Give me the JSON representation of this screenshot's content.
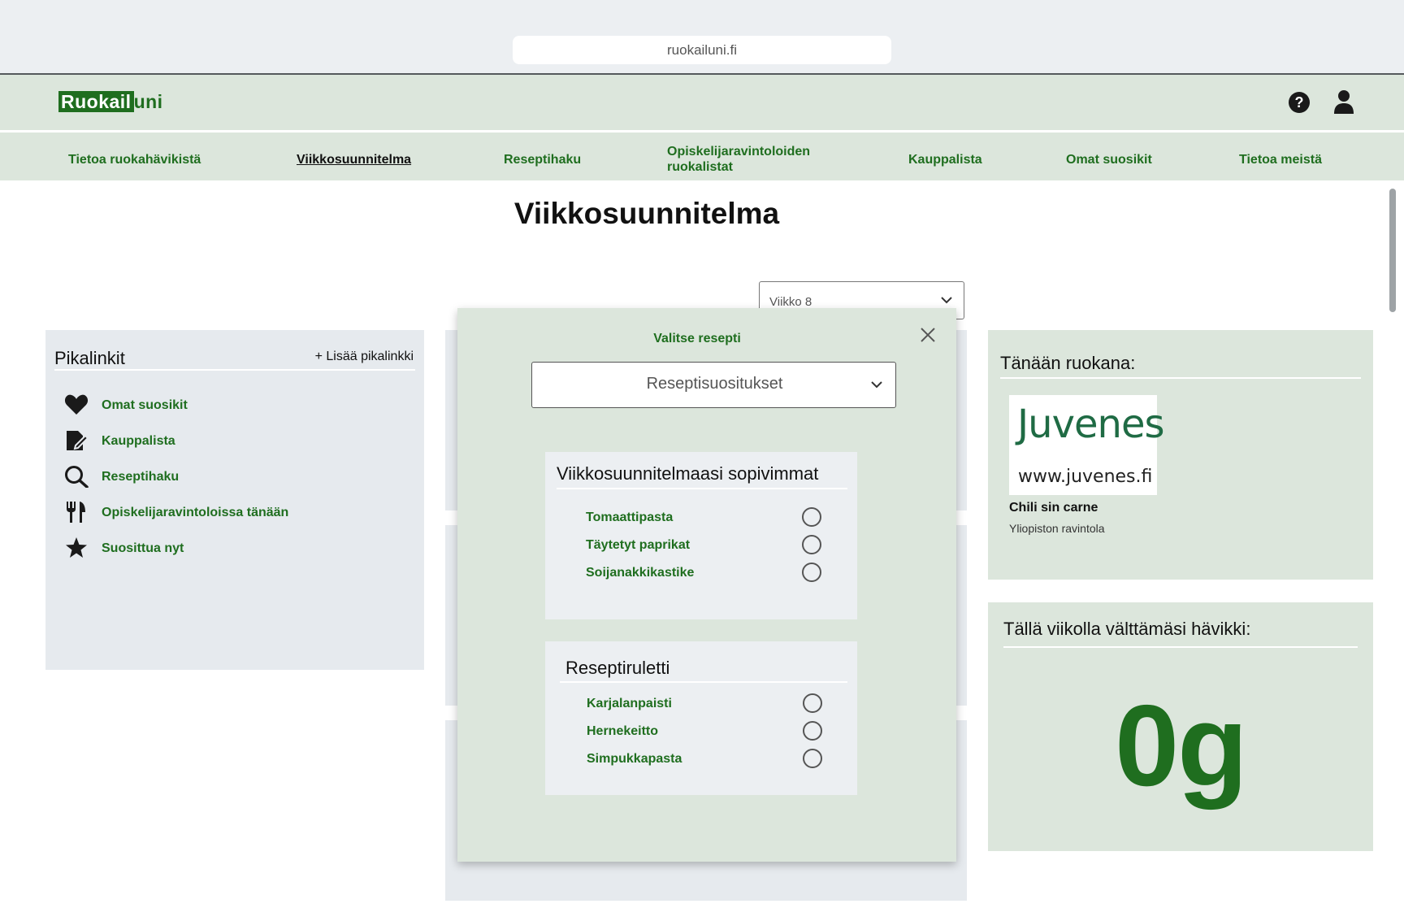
{
  "browser": {
    "url": "ruokailuni.fi"
  },
  "header": {
    "logo_highlight": "Ruokail",
    "logo_rest": "uni"
  },
  "nav": {
    "items": [
      {
        "label": "Tietoa ruokahävikistä"
      },
      {
        "label": "Viikkosuunnitelma",
        "active": true
      },
      {
        "label": "Reseptihaku"
      },
      {
        "label": "Opiskelijaravintoloiden ruokalistat"
      },
      {
        "label": "Kauppalista"
      },
      {
        "label": "Omat suosikit"
      },
      {
        "label": "Tietoa meistä"
      }
    ]
  },
  "page": {
    "title": "Viikkosuunnitelma"
  },
  "week_select": {
    "value": "Viikko 8"
  },
  "pikalinkit": {
    "title": "Pikalinkit",
    "add_label": "+ Lisää pikalinkki",
    "items": [
      {
        "label": "Omat suosikit",
        "icon": "heart-icon"
      },
      {
        "label": "Kauppalista",
        "icon": "edit-list-icon"
      },
      {
        "label": "Reseptihaku",
        "icon": "search-icon"
      },
      {
        "label": "Opiskelijaravintoloissa tänään",
        "icon": "cutlery-icon"
      },
      {
        "label": "Suosittua nyt",
        "icon": "star-icon"
      }
    ]
  },
  "today": {
    "title": "Tänään ruokana:",
    "logo_word": "Juvenes",
    "logo_url": "www.juvenes.fi",
    "dish": "Chili sin carne",
    "place": "Yliopiston ravintola"
  },
  "waste": {
    "title": "Tällä viikolla välttämäsi hävikki:",
    "value": "0g"
  },
  "modal": {
    "title": "Valitse resepti",
    "select_value": "Reseptisuositukset",
    "groups": [
      {
        "title": "Viikkosuunnitelmaasi sopivimmat",
        "options": [
          "Tomaattipasta",
          "Täytetyt paprikat",
          "Soijanakkikastike"
        ]
      },
      {
        "title": "Reseptiruletti",
        "options": [
          "Karjalanpaisti",
          "Hernekeitto",
          "Simpukkapasta"
        ]
      }
    ]
  },
  "colors": {
    "brand_green": "#1f6e1f",
    "panel_green": "#dce6dc",
    "panel_gray": "#e6eaee"
  }
}
